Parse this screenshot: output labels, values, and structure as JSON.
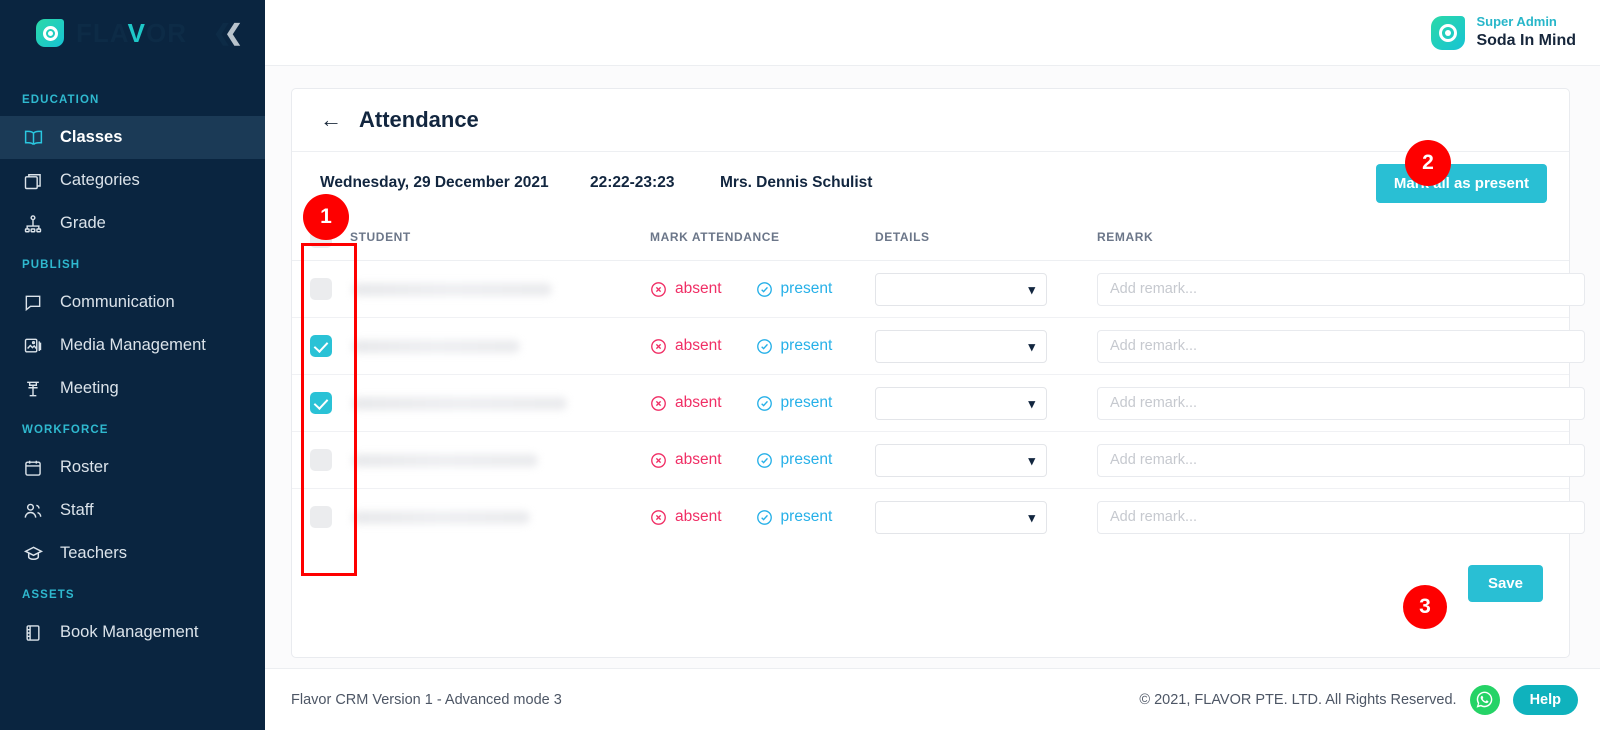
{
  "brand": {
    "logo_text_1": "FLA",
    "logo_text_2": "V",
    "logo_text_3": "OR",
    "collapse_icon": "chevrons-left-icon"
  },
  "user": {
    "role": "Super Admin",
    "name": "Soda In Mind"
  },
  "sidebar": {
    "sections": [
      {
        "label": "EDUCATION",
        "items": [
          {
            "label": "Classes",
            "icon": "book-open-icon",
            "active": true
          },
          {
            "label": "Categories",
            "icon": "box-icon",
            "active": false
          },
          {
            "label": "Grade",
            "icon": "hierarchy-icon",
            "active": false
          }
        ]
      },
      {
        "label": "PUBLISH",
        "items": [
          {
            "label": "Communication",
            "icon": "message-square-icon",
            "active": false
          },
          {
            "label": "Media Management",
            "icon": "image-stack-icon",
            "active": false
          },
          {
            "label": "Meeting",
            "icon": "podium-icon",
            "active": false
          }
        ]
      },
      {
        "label": "WORKFORCE",
        "items": [
          {
            "label": "Roster",
            "icon": "calendar-icon",
            "active": false
          },
          {
            "label": "Staff",
            "icon": "users-icon",
            "active": false
          },
          {
            "label": "Teachers",
            "icon": "graduation-cap-icon",
            "active": false
          }
        ]
      },
      {
        "label": "ASSETS",
        "items": [
          {
            "label": "Book Management",
            "icon": "book-icon",
            "active": false
          }
        ]
      }
    ]
  },
  "page": {
    "title": "Attendance",
    "back_icon": "arrow-left-icon"
  },
  "session": {
    "date": "Wednesday, 29 December 2021",
    "time": "22:22-23:23",
    "teacher": "Mrs. Dennis Schulist",
    "mark_all_label": "Mark all as present"
  },
  "table": {
    "headers": [
      "",
      "STUDENT",
      "MARK ATTENDANCE",
      "DETAILS",
      "REMARK"
    ],
    "header_checkbox_checked": false,
    "absent_label": "absent",
    "present_label": "present",
    "remark_placeholder": "Add remark...",
    "details_value": "",
    "rows": [
      {
        "checked": false,
        "student": "",
        "attendance": "",
        "details": "",
        "remark": ""
      },
      {
        "checked": true,
        "student": "",
        "attendance": "",
        "details": "",
        "remark": ""
      },
      {
        "checked": true,
        "student": "",
        "attendance": "",
        "details": "",
        "remark": ""
      },
      {
        "checked": false,
        "student": "",
        "attendance": "",
        "details": "",
        "remark": ""
      },
      {
        "checked": false,
        "student": "",
        "attendance": "",
        "details": "",
        "remark": ""
      }
    ]
  },
  "actions": {
    "save_label": "Save"
  },
  "footer": {
    "version": "Flavor CRM Version 1 - Advanced mode 3",
    "copyright": "© 2021, FLAVOR PTE. LTD. All Rights Reserved.",
    "whatsapp_icon": "whatsapp-icon",
    "help_label": "Help"
  },
  "annotations": {
    "badge_1": "1",
    "badge_2": "2",
    "badge_3": "3"
  },
  "colors": {
    "sidebar_bg": "#0a2540",
    "sidebar_active": "#1b3a56",
    "accent_teal": "#29bfd4",
    "section_label": "#2fb9cf",
    "absent_red": "#f02e65",
    "present_blue": "#26b0e8",
    "annotation_red": "#fe0000",
    "whatsapp_green": "#25d366",
    "help_teal": "#0fb2bd"
  }
}
